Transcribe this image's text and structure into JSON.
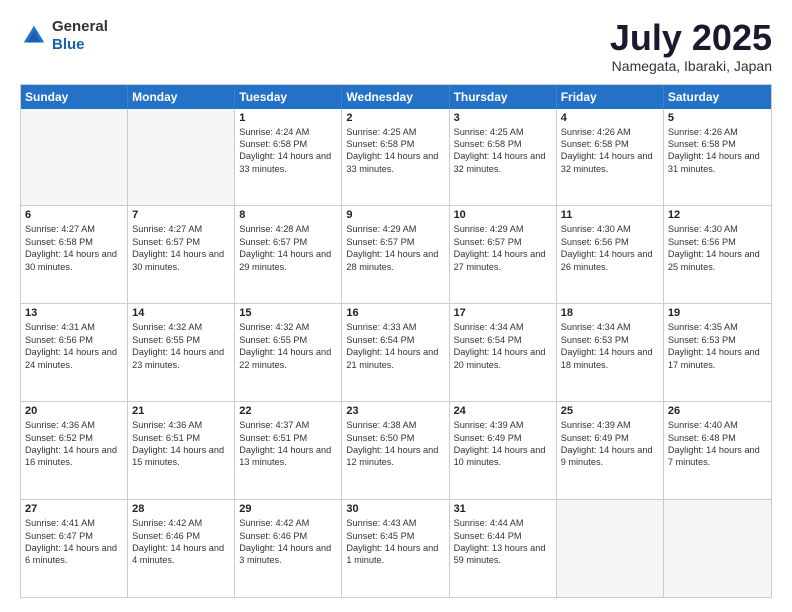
{
  "header": {
    "logo_general": "General",
    "logo_blue": "Blue",
    "month_title": "July 2025",
    "location": "Namegata, Ibaraki, Japan"
  },
  "days_of_week": [
    "Sunday",
    "Monday",
    "Tuesday",
    "Wednesday",
    "Thursday",
    "Friday",
    "Saturday"
  ],
  "weeks": [
    [
      {
        "day": "",
        "empty": true
      },
      {
        "day": "",
        "empty": true
      },
      {
        "day": "1",
        "sunrise": "Sunrise: 4:24 AM",
        "sunset": "Sunset: 6:58 PM",
        "daylight": "Daylight: 14 hours and 33 minutes."
      },
      {
        "day": "2",
        "sunrise": "Sunrise: 4:25 AM",
        "sunset": "Sunset: 6:58 PM",
        "daylight": "Daylight: 14 hours and 33 minutes."
      },
      {
        "day": "3",
        "sunrise": "Sunrise: 4:25 AM",
        "sunset": "Sunset: 6:58 PM",
        "daylight": "Daylight: 14 hours and 32 minutes."
      },
      {
        "day": "4",
        "sunrise": "Sunrise: 4:26 AM",
        "sunset": "Sunset: 6:58 PM",
        "daylight": "Daylight: 14 hours and 32 minutes."
      },
      {
        "day": "5",
        "sunrise": "Sunrise: 4:26 AM",
        "sunset": "Sunset: 6:58 PM",
        "daylight": "Daylight: 14 hours and 31 minutes."
      }
    ],
    [
      {
        "day": "6",
        "sunrise": "Sunrise: 4:27 AM",
        "sunset": "Sunset: 6:58 PM",
        "daylight": "Daylight: 14 hours and 30 minutes."
      },
      {
        "day": "7",
        "sunrise": "Sunrise: 4:27 AM",
        "sunset": "Sunset: 6:57 PM",
        "daylight": "Daylight: 14 hours and 30 minutes."
      },
      {
        "day": "8",
        "sunrise": "Sunrise: 4:28 AM",
        "sunset": "Sunset: 6:57 PM",
        "daylight": "Daylight: 14 hours and 29 minutes."
      },
      {
        "day": "9",
        "sunrise": "Sunrise: 4:29 AM",
        "sunset": "Sunset: 6:57 PM",
        "daylight": "Daylight: 14 hours and 28 minutes."
      },
      {
        "day": "10",
        "sunrise": "Sunrise: 4:29 AM",
        "sunset": "Sunset: 6:57 PM",
        "daylight": "Daylight: 14 hours and 27 minutes."
      },
      {
        "day": "11",
        "sunrise": "Sunrise: 4:30 AM",
        "sunset": "Sunset: 6:56 PM",
        "daylight": "Daylight: 14 hours and 26 minutes."
      },
      {
        "day": "12",
        "sunrise": "Sunrise: 4:30 AM",
        "sunset": "Sunset: 6:56 PM",
        "daylight": "Daylight: 14 hours and 25 minutes."
      }
    ],
    [
      {
        "day": "13",
        "sunrise": "Sunrise: 4:31 AM",
        "sunset": "Sunset: 6:56 PM",
        "daylight": "Daylight: 14 hours and 24 minutes."
      },
      {
        "day": "14",
        "sunrise": "Sunrise: 4:32 AM",
        "sunset": "Sunset: 6:55 PM",
        "daylight": "Daylight: 14 hours and 23 minutes."
      },
      {
        "day": "15",
        "sunrise": "Sunrise: 4:32 AM",
        "sunset": "Sunset: 6:55 PM",
        "daylight": "Daylight: 14 hours and 22 minutes."
      },
      {
        "day": "16",
        "sunrise": "Sunrise: 4:33 AM",
        "sunset": "Sunset: 6:54 PM",
        "daylight": "Daylight: 14 hours and 21 minutes."
      },
      {
        "day": "17",
        "sunrise": "Sunrise: 4:34 AM",
        "sunset": "Sunset: 6:54 PM",
        "daylight": "Daylight: 14 hours and 20 minutes."
      },
      {
        "day": "18",
        "sunrise": "Sunrise: 4:34 AM",
        "sunset": "Sunset: 6:53 PM",
        "daylight": "Daylight: 14 hours and 18 minutes."
      },
      {
        "day": "19",
        "sunrise": "Sunrise: 4:35 AM",
        "sunset": "Sunset: 6:53 PM",
        "daylight": "Daylight: 14 hours and 17 minutes."
      }
    ],
    [
      {
        "day": "20",
        "sunrise": "Sunrise: 4:36 AM",
        "sunset": "Sunset: 6:52 PM",
        "daylight": "Daylight: 14 hours and 16 minutes."
      },
      {
        "day": "21",
        "sunrise": "Sunrise: 4:36 AM",
        "sunset": "Sunset: 6:51 PM",
        "daylight": "Daylight: 14 hours and 15 minutes."
      },
      {
        "day": "22",
        "sunrise": "Sunrise: 4:37 AM",
        "sunset": "Sunset: 6:51 PM",
        "daylight": "Daylight: 14 hours and 13 minutes."
      },
      {
        "day": "23",
        "sunrise": "Sunrise: 4:38 AM",
        "sunset": "Sunset: 6:50 PM",
        "daylight": "Daylight: 14 hours and 12 minutes."
      },
      {
        "day": "24",
        "sunrise": "Sunrise: 4:39 AM",
        "sunset": "Sunset: 6:49 PM",
        "daylight": "Daylight: 14 hours and 10 minutes."
      },
      {
        "day": "25",
        "sunrise": "Sunrise: 4:39 AM",
        "sunset": "Sunset: 6:49 PM",
        "daylight": "Daylight: 14 hours and 9 minutes."
      },
      {
        "day": "26",
        "sunrise": "Sunrise: 4:40 AM",
        "sunset": "Sunset: 6:48 PM",
        "daylight": "Daylight: 14 hours and 7 minutes."
      }
    ],
    [
      {
        "day": "27",
        "sunrise": "Sunrise: 4:41 AM",
        "sunset": "Sunset: 6:47 PM",
        "daylight": "Daylight: 14 hours and 6 minutes."
      },
      {
        "day": "28",
        "sunrise": "Sunrise: 4:42 AM",
        "sunset": "Sunset: 6:46 PM",
        "daylight": "Daylight: 14 hours and 4 minutes."
      },
      {
        "day": "29",
        "sunrise": "Sunrise: 4:42 AM",
        "sunset": "Sunset: 6:46 PM",
        "daylight": "Daylight: 14 hours and 3 minutes."
      },
      {
        "day": "30",
        "sunrise": "Sunrise: 4:43 AM",
        "sunset": "Sunset: 6:45 PM",
        "daylight": "Daylight: 14 hours and 1 minute."
      },
      {
        "day": "31",
        "sunrise": "Sunrise: 4:44 AM",
        "sunset": "Sunset: 6:44 PM",
        "daylight": "Daylight: 13 hours and 59 minutes."
      },
      {
        "day": "",
        "empty": true
      },
      {
        "day": "",
        "empty": true
      }
    ]
  ]
}
